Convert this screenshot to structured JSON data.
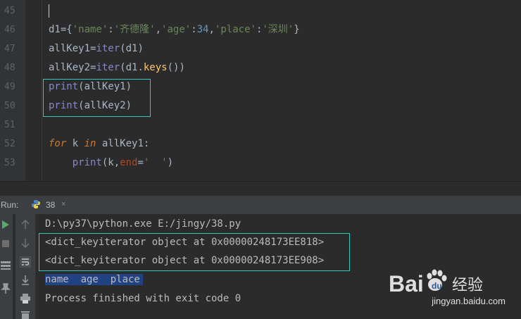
{
  "editor": {
    "line_numbers": [
      "45",
      "46",
      "47",
      "48",
      "49",
      "50",
      "51",
      "52",
      "53"
    ],
    "lines": [
      "",
      "d1={'name':'齐德隆','age':34,'place':'深圳'}",
      "allKey1=iter(d1)",
      "allKey2=iter(d1.keys())",
      "print(allKey1)",
      "print(allKey2)",
      "",
      "for k in allKey1:",
      "    print(k,end='  ')"
    ],
    "tokens": {
      "l46_a": "d1={",
      "l46_k1": "'name'",
      "l46_c1": ":",
      "l46_v1": "'齐德隆'",
      "l46_c2": ",",
      "l46_k2": "'age'",
      "l46_c3": ":",
      "l46_v2": "34",
      "l46_c4": ",",
      "l46_k3": "'place'",
      "l46_c5": ":",
      "l46_v3": "'深圳'",
      "l46_end": "}",
      "l47_a": "allKey1=",
      "l47_fn": "iter",
      "l47_b": "(d1)",
      "l48_a": "allKey2=",
      "l48_fn": "iter",
      "l48_b": "(d1.",
      "l48_m": "keys",
      "l48_c": "())",
      "l49_fn": "print",
      "l49_b": "(allKey1)",
      "l50_fn": "print",
      "l50_b": "(allKey2)",
      "l52_for": "for",
      "l52_k": " k ",
      "l52_in": "in",
      "l52_rest": " allKey1:",
      "l53_ind": "    ",
      "l53_fn": "print",
      "l53_b": "(k,",
      "l53_kw": "end",
      "l53_eq": "=",
      "l53_s": "'  '",
      "l53_end": ")"
    }
  },
  "run_panel": {
    "label": "Run:",
    "tab_name": "38",
    "tab_close": "×"
  },
  "console": {
    "lines": [
      "D:\\py37\\python.exe E:/jingy/38.py",
      "<dict_keyiterator object at 0x00000248173EE818>",
      "<dict_keyiterator object at 0x00000248173EE908>",
      "name  age  place",
      "Process finished with exit code 0"
    ]
  },
  "watermark": {
    "brand": "Bai经验",
    "url": "jingyan.baidu.com"
  },
  "colors": {
    "highlight_box": "#35c7c2",
    "selection": "#214283",
    "keyword": "#cc7832",
    "string": "#6a8759",
    "number": "#6897bb"
  }
}
